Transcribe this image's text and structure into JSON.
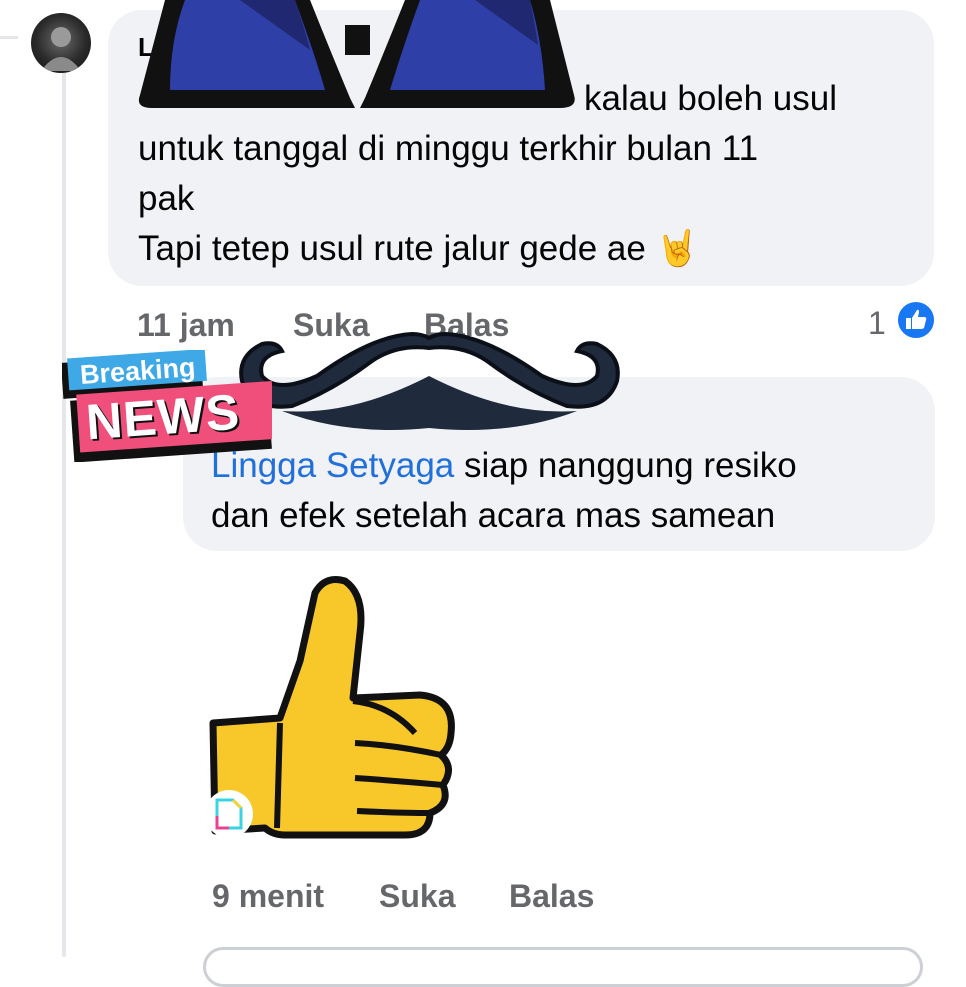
{
  "comment1": {
    "author_visible": "Li                    aga",
    "text_line1": "kalau boleh usul",
    "text_line2": "untuk tanggal di minggu terkhir bulan 11",
    "text_line3": "pak",
    "text_line4": "Tapi tetep usul rute jalur gede ae 🤘",
    "time": "11 jam",
    "like_label": "Suka",
    "reply_label": "Balas",
    "reaction_count": "1"
  },
  "comment2": {
    "mention": "Lingga Setyaga",
    "text_line1_rest": " siap nanggung resiko",
    "text_line2": "dan efek setelah acara mas samean",
    "time": "9 menit",
    "like_label": "Suka",
    "reply_label": "Balas"
  },
  "sticker": {
    "breaking_label": "Breaking",
    "news_label": "NEWS"
  },
  "colors": {
    "bubble": "#f0f2f5",
    "mention": "#216fdb",
    "meta": "#65676b",
    "like_blue": "#1877f2",
    "sticker_yellow": "#f8c82a"
  }
}
